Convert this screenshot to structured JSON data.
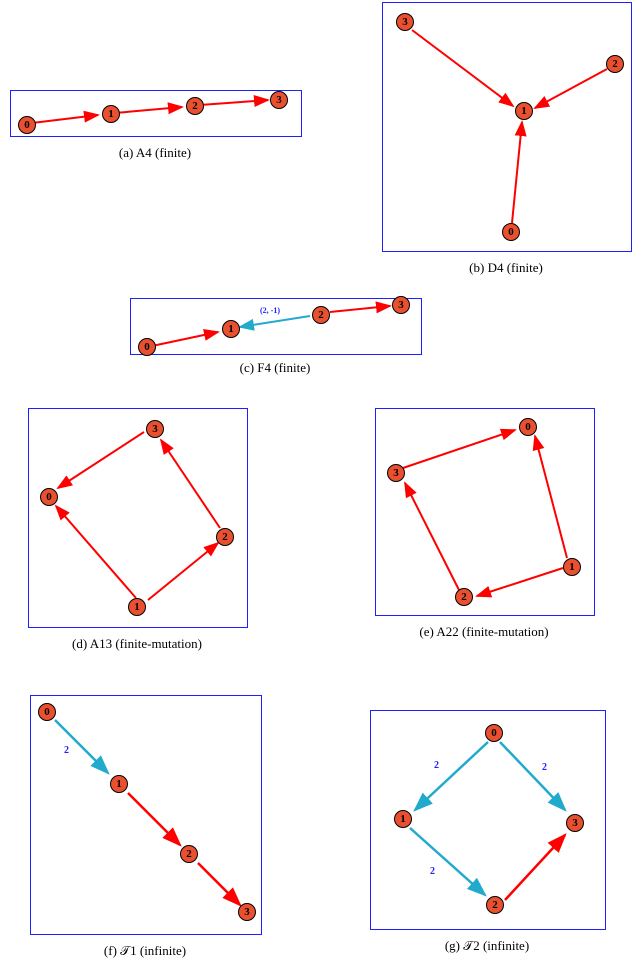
{
  "panels": [
    {
      "id": "a",
      "caption": "(a) A4 (finite)"
    },
    {
      "id": "b",
      "caption": "(b) D4 (finite)"
    },
    {
      "id": "c",
      "caption": "(c) F4 (finite)"
    },
    {
      "id": "d",
      "caption": "(d) A13 (finite-mutation)"
    },
    {
      "id": "e",
      "caption": "(e) A22 (finite-mutation)"
    },
    {
      "id": "f",
      "caption": "(f) 𝒯1 (infinite)"
    },
    {
      "id": "g",
      "caption": "(g) 𝒯2 (infinite)"
    }
  ],
  "nodes": {
    "a": {
      "0": "0",
      "1": "1",
      "2": "2",
      "3": "3"
    },
    "b": {
      "0": "0",
      "1": "1",
      "2": "2",
      "3": "3"
    },
    "c": {
      "0": "0",
      "1": "1",
      "2": "2",
      "3": "3",
      "label": "(2, -1)"
    },
    "d": {
      "0": "0",
      "1": "1",
      "2": "2",
      "3": "3"
    },
    "e": {
      "0": "0",
      "1": "1",
      "2": "2",
      "3": "3"
    },
    "f": {
      "0": "0",
      "1": "1",
      "2": "2",
      "3": "3",
      "l01": "2"
    },
    "g": {
      "0": "0",
      "1": "1",
      "2": "2",
      "3": "3",
      "l01": "2",
      "l12": "2",
      "l03": "2"
    }
  },
  "chart_data": {
    "type": "diagram",
    "description": "Seven quiver diagrams of small Dynkin-like quivers on 4 vertices.",
    "quivers": [
      {
        "name": "A4",
        "classification": "finite",
        "vertices": [
          0,
          1,
          2,
          3
        ],
        "arrows": [
          [
            0,
            1
          ],
          [
            1,
            2
          ],
          [
            2,
            3
          ]
        ]
      },
      {
        "name": "D4",
        "classification": "finite",
        "vertices": [
          0,
          1,
          2,
          3
        ],
        "arrows": [
          [
            0,
            1
          ],
          [
            2,
            1
          ],
          [
            3,
            1
          ]
        ]
      },
      {
        "name": "F4",
        "classification": "finite",
        "vertices": [
          0,
          1,
          2,
          3
        ],
        "arrows": [
          [
            0,
            1
          ],
          [
            2,
            1,
            "(2,-1)"
          ],
          [
            2,
            3
          ]
        ]
      },
      {
        "name": "A13",
        "classification": "finite-mutation",
        "vertices": [
          0,
          1,
          2,
          3
        ],
        "arrows": [
          [
            1,
            0
          ],
          [
            1,
            2
          ],
          [
            2,
            3
          ],
          [
            3,
            0
          ]
        ]
      },
      {
        "name": "A22",
        "classification": "finite-mutation",
        "vertices": [
          0,
          1,
          2,
          3
        ],
        "arrows": [
          [
            2,
            3
          ],
          [
            3,
            0
          ],
          [
            1,
            0
          ],
          [
            1,
            2
          ]
        ]
      },
      {
        "name": "T1",
        "classification": "infinite",
        "vertices": [
          0,
          1,
          2,
          3
        ],
        "arrows": [
          [
            0,
            1,
            "2"
          ],
          [
            1,
            2
          ],
          [
            2,
            3
          ]
        ]
      },
      {
        "name": "T2",
        "classification": "infinite",
        "vertices": [
          0,
          1,
          2,
          3
        ],
        "arrows": [
          [
            0,
            1,
            "2"
          ],
          [
            1,
            2,
            "2"
          ],
          [
            0,
            3,
            "2"
          ],
          [
            2,
            3
          ]
        ]
      }
    ]
  }
}
